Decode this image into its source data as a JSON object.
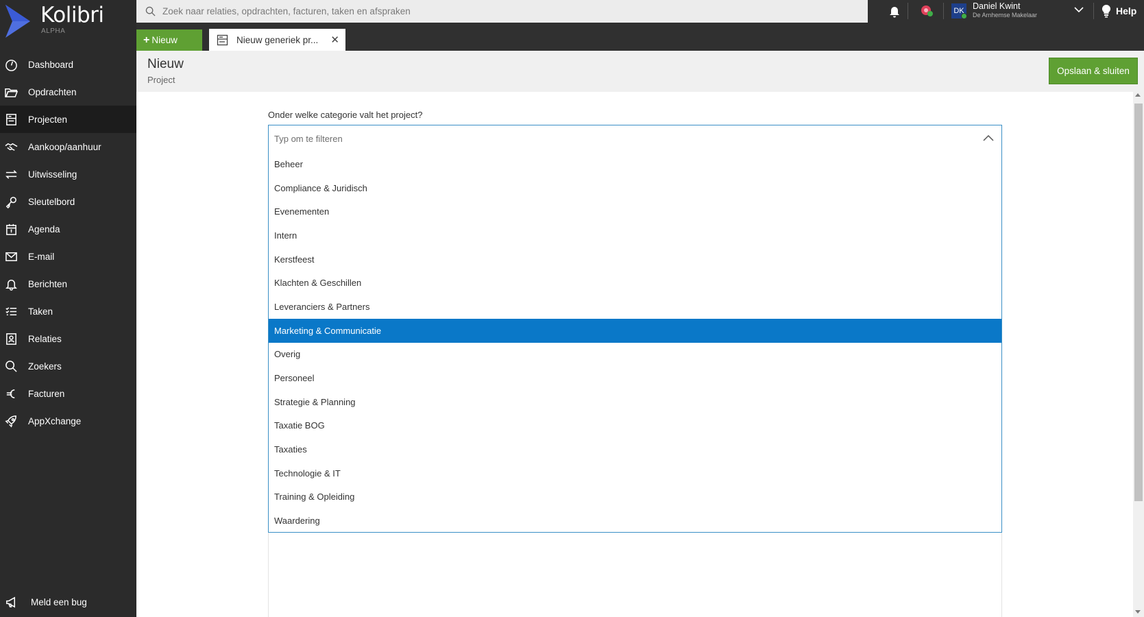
{
  "brand": {
    "name": "Kolibri",
    "sub": "ALPHA"
  },
  "sidebar": {
    "items": [
      {
        "label": "Dashboard",
        "icon": "dashboard-icon"
      },
      {
        "label": "Opdrachten",
        "icon": "folder-open-icon"
      },
      {
        "label": "Projecten",
        "icon": "projects-icon",
        "active": true
      },
      {
        "label": "Aankoop/aanhuur",
        "icon": "handshake-icon"
      },
      {
        "label": "Uitwisseling",
        "icon": "exchange-icon"
      },
      {
        "label": "Sleutelbord",
        "icon": "key-icon"
      },
      {
        "label": "Agenda",
        "icon": "calendar-icon"
      },
      {
        "label": "E-mail",
        "icon": "mail-icon"
      },
      {
        "label": "Berichten",
        "icon": "bell-icon"
      },
      {
        "label": "Taken",
        "icon": "tasks-icon"
      },
      {
        "label": "Relaties",
        "icon": "contact-icon"
      },
      {
        "label": "Zoekers",
        "icon": "search-icon"
      },
      {
        "label": "Facturen",
        "icon": "euro-icon"
      },
      {
        "label": "AppXchange",
        "icon": "rocket-icon"
      }
    ],
    "bug_label": "Meld een bug"
  },
  "topbar": {
    "search_placeholder": "Zoek naar relaties, opdrachten, facturen, taken en afspraken",
    "user": {
      "initials": "DK",
      "name": "Daniel Kwint",
      "org": "De Arnhemse Makelaar"
    },
    "help_label": "Help",
    "new_label": "Nieuw",
    "tab_label": "Nieuw generiek pr..."
  },
  "header": {
    "title": "Nieuw",
    "subtitle": "Project",
    "save_label": "Opslaan & sluiten"
  },
  "form": {
    "label": "Onder welke categorie valt het project?",
    "filter_placeholder": "Typ om te filteren",
    "options": [
      "Beheer",
      "Compliance & Juridisch",
      "Evenementen",
      "Intern",
      "Kerstfeest",
      "Klachten & Geschillen",
      "Leveranciers & Partners",
      "Marketing & Communicatie",
      "Overig",
      "Personeel",
      "Strategie & Planning",
      "Taxatie BOG",
      "Taxaties",
      "Technologie & IT",
      "Training & Opleiding",
      "Waardering"
    ],
    "selected_option": "Marketing & Communicatie"
  },
  "colors": {
    "sidebar_bg": "#2b2b2b",
    "topbar_bg": "#303030",
    "accent_green": "#5fa033",
    "selected_blue": "#0a78c8",
    "focus_border": "#3a8fc6"
  }
}
